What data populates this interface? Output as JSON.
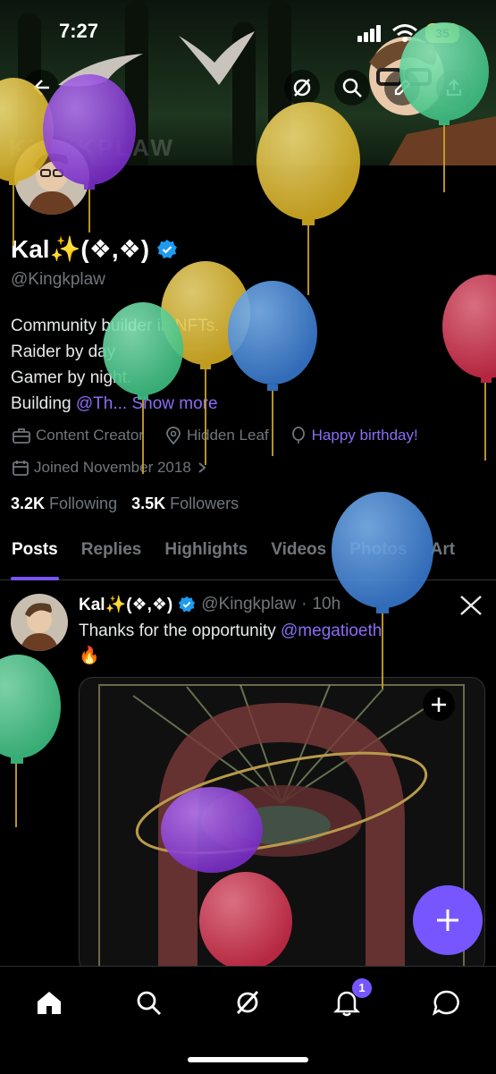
{
  "status_bar": {
    "time": "7:27",
    "battery": "35"
  },
  "banner": {
    "watermark_text": "KINGKPLAW"
  },
  "profile": {
    "name": "Kal✨(❖,❖)",
    "handle": "@Kingkplaw",
    "bio_lines": [
      "Community builder in NFTs.",
      "Raider by day",
      "Gamer by night."
    ],
    "bio_building_prefix": "Building ",
    "bio_building_link": "@Th...",
    "show_more": "Show more",
    "category": "Content Creator",
    "location": "Hidden Leaf",
    "birthday": "Happy birthday!",
    "joined": "Joined November 2018",
    "following_count": "3.2K",
    "following_label": "Following",
    "followers_count": "3.5K",
    "followers_label": "Followers"
  },
  "tabs": [
    "Posts",
    "Replies",
    "Highlights",
    "Videos",
    "Photos",
    "Art"
  ],
  "tweet": {
    "name": "Kal✨(❖,❖)",
    "handle": "@Kingkplaw",
    "time": "10h",
    "text": "Thanks for the opportunity ",
    "mention": "@megatioeth",
    "emoji": "🔥"
  },
  "bottom_nav": {
    "notification_count": "1"
  },
  "colors": {
    "accent": "#7856ff",
    "verified": "#1d9bf0",
    "balloon_yellow": "#e8c63a",
    "balloon_purple": "#8a3fd8",
    "balloon_green": "#5fd49a",
    "balloon_blue": "#4a90e2",
    "balloon_red": "#e0405a"
  }
}
